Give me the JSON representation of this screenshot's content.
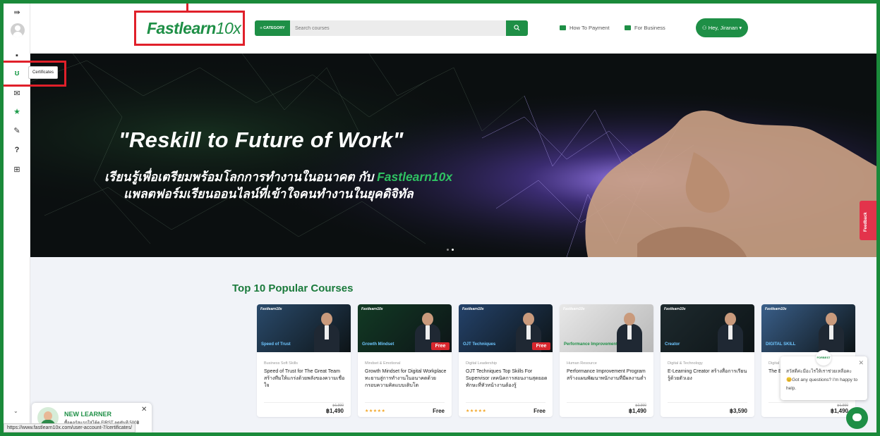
{
  "sidebar": {
    "tooltip": "Certificates",
    "icons": [
      "menu-toggle-icon",
      "avatar",
      "book-icon",
      "certificate-icon",
      "mail-icon",
      "star-icon",
      "pen-icon",
      "help-icon",
      "basket-icon"
    ]
  },
  "header": {
    "logo_main": "Fastlearn",
    "logo_suffix": "10x",
    "category_label": "≡ CATEGORY",
    "search_placeholder": "Search courses",
    "how_to_payment": "How To Payment",
    "for_business": "For Business",
    "user_label": "Hey, Jiranan ▾"
  },
  "hero": {
    "title": "\"Reskill to Future of Work\"",
    "sub1_prefix": "เรียนรู้เพื่อเตรียมพร้อมโลกการทำงานในอนาคต กับ ",
    "sub1_brand": "Fastlearn10x",
    "sub2": "แพลตฟอร์มเรียนออนไลน์ที่เข้าใจคนทำงานในยุคดิจิทัล",
    "feedback": "Feedback"
  },
  "courses": {
    "section_title": "Top 10 Popular Courses",
    "items": [
      {
        "category": "Business Soft Skills",
        "title": "Speed of Trust for The Great Team สร้างทีมให้แกร่งด้วยพลังของความเชื่อใจ",
        "old_price": "฿1,990",
        "price": "฿1,490",
        "stars": "",
        "free_badge": "",
        "thumb_tag": "Speed of Trust",
        "thumb_color": "#2a4a6b"
      },
      {
        "category": "Mindset & Emotional",
        "title": "Growth Mindset for Digital Workplace ทะยานสู่การทำงานในอนาคตด้วยกรอบความคิดแบบเติบโต",
        "old_price": "",
        "price": "Free",
        "stars": "★★★★★",
        "free_badge": "Free",
        "thumb_tag": "Growth Mindset",
        "thumb_color": "#123a24"
      },
      {
        "category": "Digital Leadership",
        "title": "OJT Techniques Top Skills For Supervisor เทคนิคการสอนงานสุดยอดทักษะที่หัวหน้างานต้องรู้",
        "old_price": "",
        "price": "Free",
        "stars": "★★★★★",
        "free_badge": "Free",
        "thumb_tag": "OJT Techniques",
        "thumb_color": "#24426a"
      },
      {
        "category": "Human Resource",
        "title": "Performance Improvement Program สร้างแผนพัฒนาพนักงานที่มีผลงานต่ำ",
        "old_price": "฿2,990",
        "price": "฿1,490",
        "stars": "",
        "free_badge": "",
        "thumb_tag": "Performance Improvement Program",
        "thumb_color": "#d9d9d9"
      },
      {
        "category": "Digital & Technology",
        "title": "E-Learning Creator สร้างสื่อการเรียนรู้ด้วยตัวเอง",
        "old_price": "",
        "price": "฿3,590",
        "stars": "",
        "free_badge": "",
        "thumb_tag": "Creator",
        "thumb_color": "#1e2a2e"
      },
      {
        "category": "Digital",
        "title": "The Es สู่โลกอ จำเป็นใ",
        "old_price": "฿1,990",
        "price": "฿1,490",
        "stars": "",
        "free_badge": "",
        "thumb_tag": "DIGITAL SKILL",
        "thumb_color": "#3a5f8a"
      }
    ]
  },
  "chat": {
    "logo_text": "FORBEST",
    "message": "สวัสดีค่ะมีอะไรให้เราช่วยเหลือคะ 😊Got any questions? I'm happy to help.",
    "close": "✕"
  },
  "learner_popup": {
    "title": "NEW LEARNER",
    "subtitle": "ซื้อคอร์สแรกใส่โค้ด FIRST ลดทันที 500฿",
    "close": "✕"
  },
  "status_bar": {
    "url": "https://www.fastlearn10x.com/user-account-7/certificates/"
  },
  "colors": {
    "brand_green": "#1e8f46",
    "annotation_red": "#e0202a",
    "frame_green": "#1a8a3a"
  }
}
